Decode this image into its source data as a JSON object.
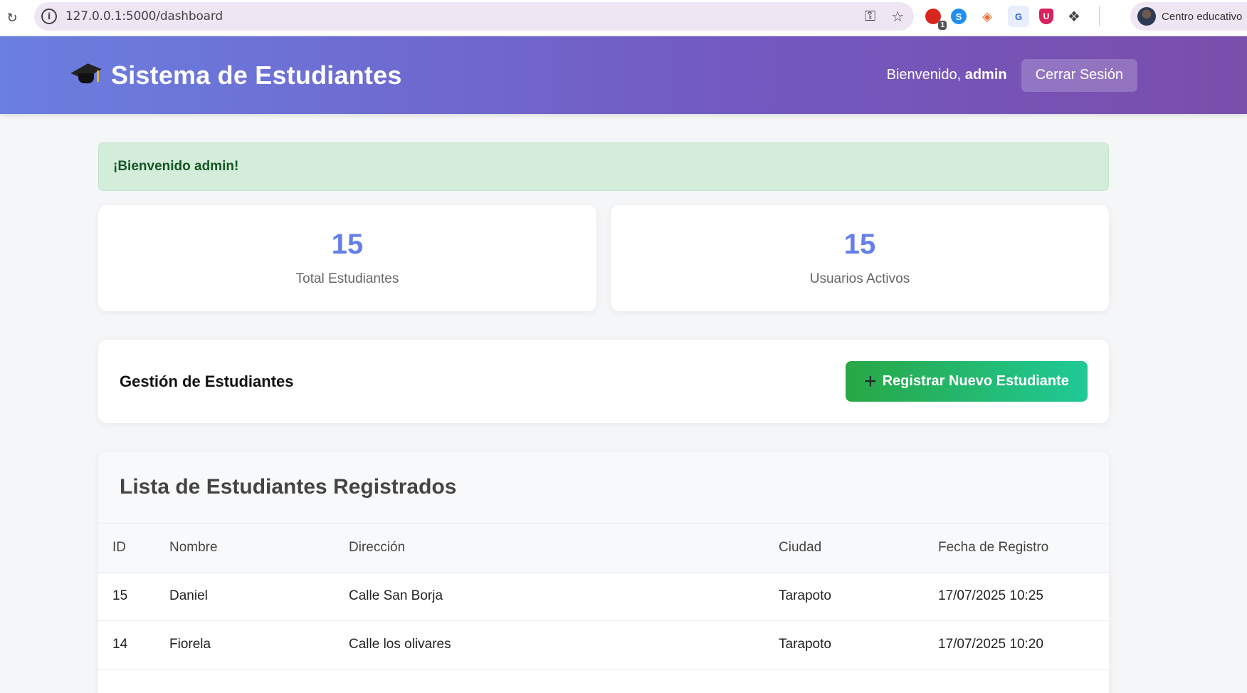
{
  "browser": {
    "url": "127.0.0.1:5000/dashboard",
    "profile_name": "Centro educativo",
    "extension_badge": "1"
  },
  "header": {
    "title": "Sistema de Estudiantes",
    "welcome_prefix": "Bienvenido,",
    "username": "admin",
    "logout_label": "Cerrar Sesión"
  },
  "alert": {
    "message": "¡Bienvenido admin!"
  },
  "stats": [
    {
      "value": "15",
      "label": "Total Estudiantes"
    },
    {
      "value": "15",
      "label": "Usuarios Activos"
    }
  ],
  "management": {
    "title": "Gestión de Estudiantes",
    "register_label": "Registrar Nuevo Estudiante"
  },
  "students": {
    "title": "Lista de Estudiantes Registrados",
    "columns": [
      "ID",
      "Nombre",
      "Dirección",
      "Ciudad",
      "Fecha de Registro"
    ],
    "rows": [
      {
        "id": "15",
        "name": "Daniel",
        "address": "Calle San Borja",
        "city": "Tarapoto",
        "date": "17/07/2025 10:25"
      },
      {
        "id": "14",
        "name": "Fiorela",
        "address": "Calle los olivares",
        "city": "Tarapoto",
        "date": "17/07/2025 10:20"
      }
    ]
  },
  "colors": {
    "header_start": "#6a7fe0",
    "header_end": "#7a4eab",
    "stat_number": "#667eea",
    "alert_bg": "#d4edda",
    "alert_text": "#155724",
    "button_start": "#28a745",
    "button_end": "#20c997"
  }
}
